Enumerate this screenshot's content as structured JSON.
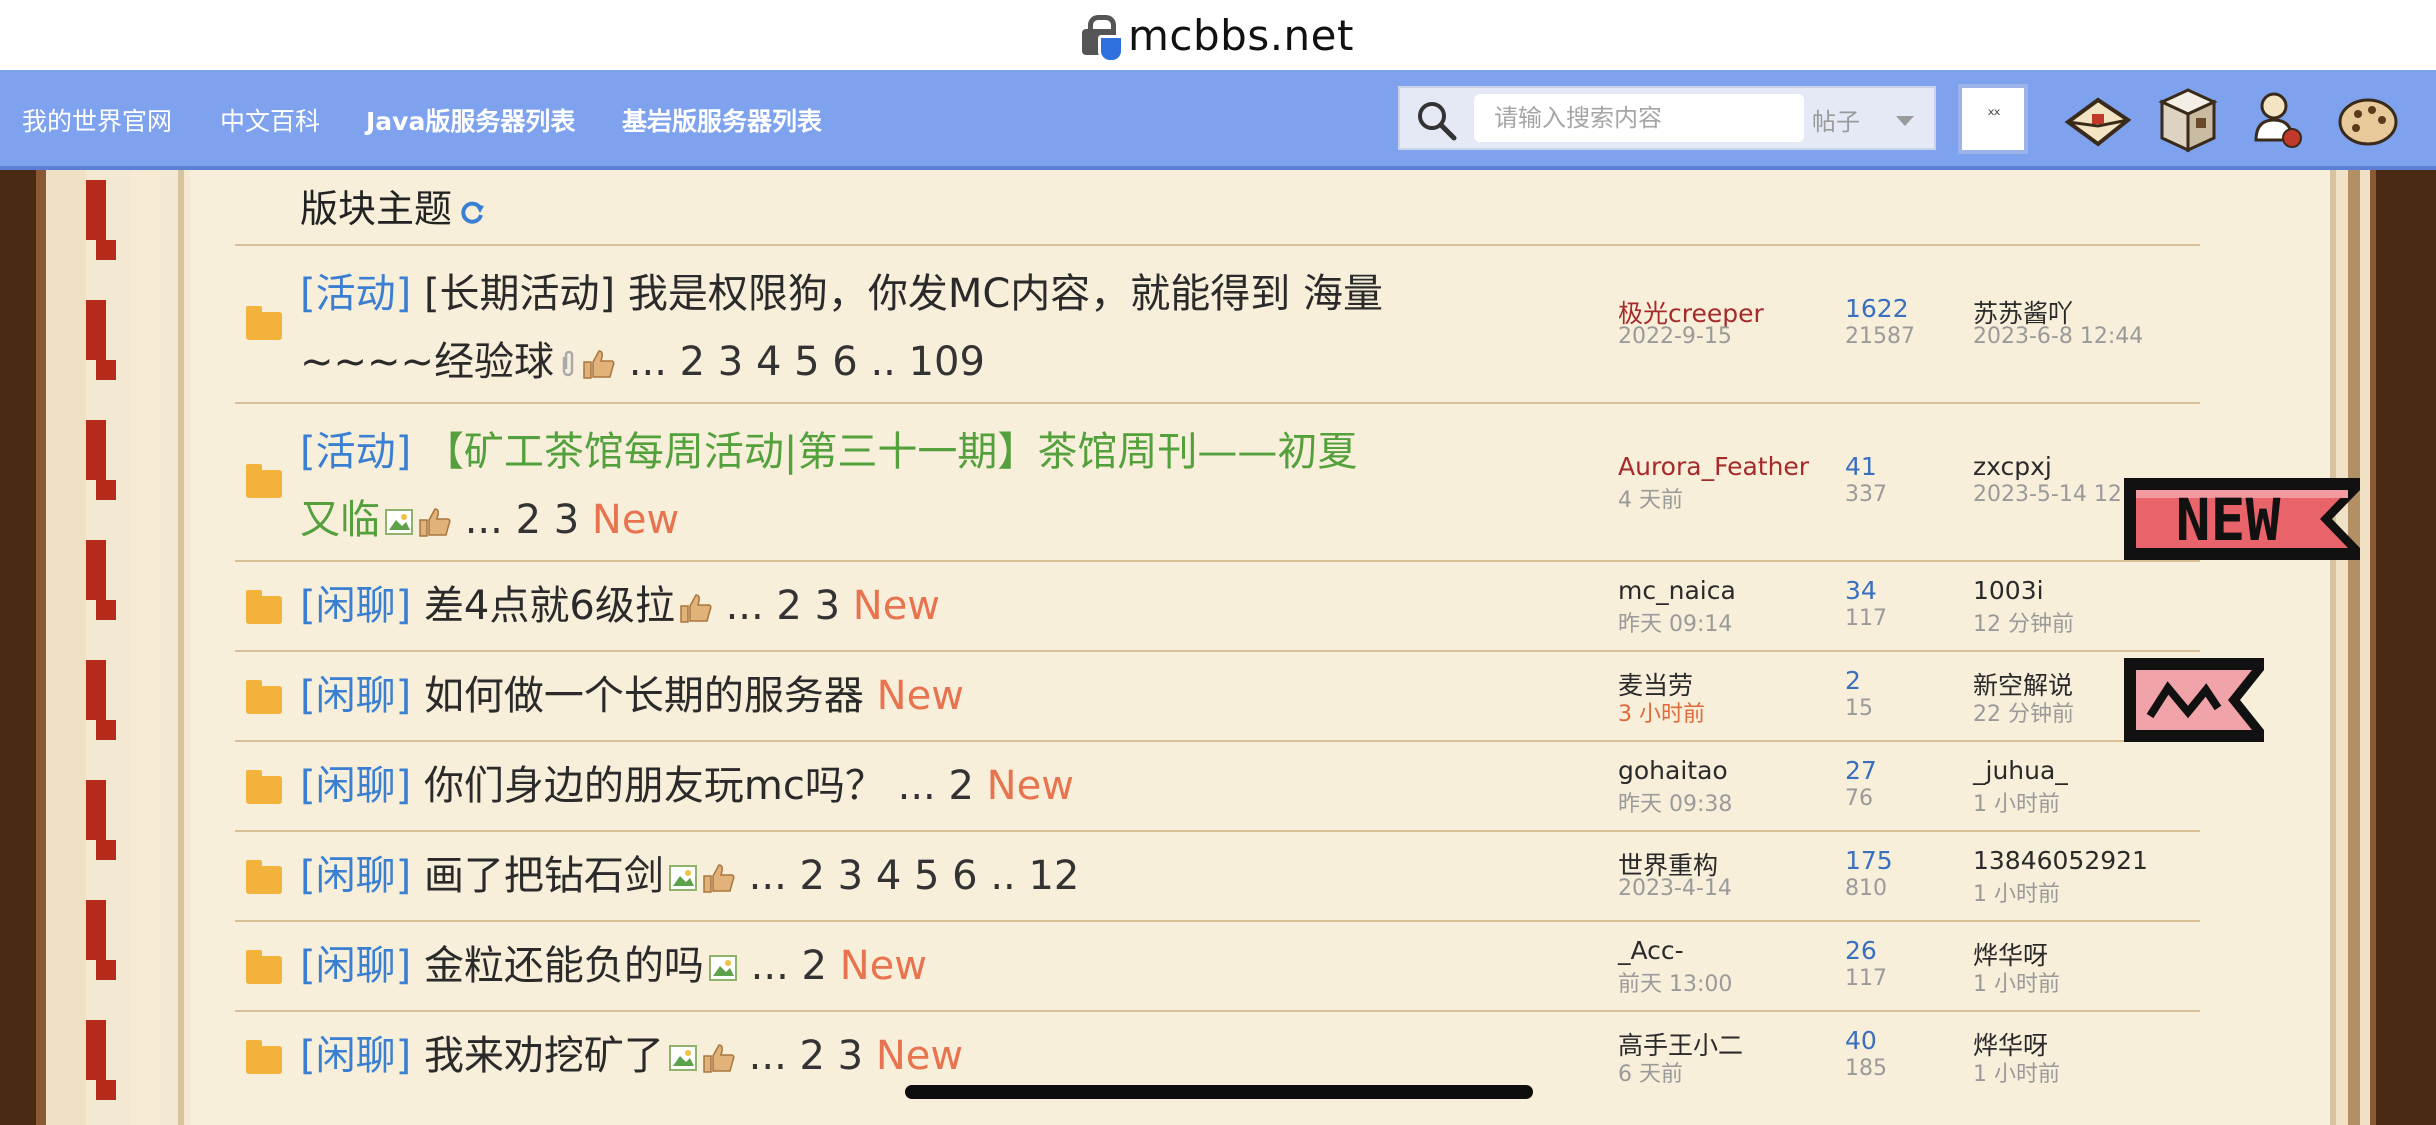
{
  "browser": {
    "url": "mcbbs.net"
  },
  "nav": {
    "links": [
      "我的世界官网",
      "中文百科",
      "Java版服务器列表",
      "基岩版服务器列表"
    ],
    "search_placeholder": "请输入搜索内容",
    "search_scope": "帖子",
    "close_label": "ˣˣ",
    "icons": [
      "letter-icon",
      "furnace-icon",
      "potion-icon",
      "palette-icon"
    ]
  },
  "section": {
    "title": "版块主题"
  },
  "threads": [
    {
      "type": "[活动]",
      "title_line1": "[长期活动] 我是权限狗，你发MC内容，就能得到 海量",
      "title_line2": "~~~~经验球",
      "pages": "... 2  3  4  5  6 .. 109",
      "new": "",
      "author": "极光creeper",
      "date": "2022-9-15",
      "replies": "1622",
      "views": "21587",
      "last_user": "苏苏酱吖",
      "last_date": "2023-6-8 12:44"
    },
    {
      "type": "[活动]",
      "title_line1": "【矿工茶馆每周活动|第三十一期】茶馆周刊——初夏",
      "title_line2": "又临",
      "pages": "... 2  3",
      "new": "New",
      "author": "Aurora_Feather",
      "date": "4 天前",
      "replies": "41",
      "views": "337",
      "last_user": "zxcpxj",
      "last_date": "2023-5-14 12:4"
    },
    {
      "type": "[闲聊]",
      "title": "差4点就6级拉",
      "pages": "... 2  3",
      "new": "New",
      "author": "mc_naica",
      "date": "昨天 09:14",
      "replies": "34",
      "views": "117",
      "last_user": "1003i",
      "last_date": "12 分钟前"
    },
    {
      "type": "[闲聊]",
      "title": "如何做一个长期的服务器",
      "pages": "",
      "new": "New",
      "author": "麦当劳",
      "date": "3 小时前",
      "replies": "2",
      "views": "15",
      "last_user": "新空解说",
      "last_date": "22 分钟前"
    },
    {
      "type": "[闲聊]",
      "title": "你们身边的朋友玩mc吗？",
      "pages": "... 2",
      "new": "New",
      "author": "gohaitao",
      "date": "昨天 09:38",
      "replies": "27",
      "views": "76",
      "last_user": "_juhua_",
      "last_date": "1 小时前"
    },
    {
      "type": "[闲聊]",
      "title": "画了把钻石剑",
      "pages": "... 2  3  4  5  6 .. 12",
      "new": "",
      "author": "世界重构",
      "date": "2023-4-14",
      "replies": "175",
      "views": "810",
      "last_user": "13846052921",
      "last_date": "1 小时前"
    },
    {
      "type": "[闲聊]",
      "title": "金粒还能负的吗",
      "pages": "... 2",
      "new": "New",
      "author": "_Acc-",
      "date": "前天 13:00",
      "replies": "26",
      "views": "117",
      "last_user": "烨华呀",
      "last_date": "1 小时前"
    },
    {
      "type": "[闲聊]",
      "title": "我来劝挖矿了",
      "pages": "... 2  3",
      "new": "New",
      "author": "高手王小二",
      "date": "6 天前",
      "replies": "40",
      "views": "185",
      "last_user": "烨华呀",
      "last_date": "1 小时前"
    }
  ],
  "badges": {
    "new_badge": "NEW"
  },
  "colors": {
    "nav_bg": "#7fa2ee",
    "type_tag": "#3a7fd2",
    "new_tag": "#e8734f",
    "page_bg": "#f7efda"
  }
}
